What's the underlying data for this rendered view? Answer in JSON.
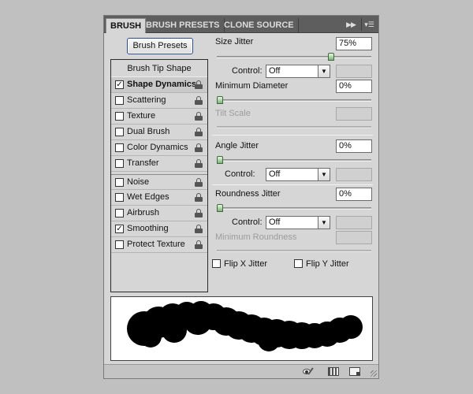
{
  "tabs": [
    {
      "label": "BRUSH",
      "active": true
    },
    {
      "label": "BRUSH PRESETS",
      "active": false
    },
    {
      "label": "CLONE SOURCE",
      "active": false
    }
  ],
  "tab_icons": {
    "more": "double-chevron-icon",
    "menu": "panel-menu-icon"
  },
  "brush_presets_button": "Brush Presets",
  "sidebar": {
    "header": "Brush Tip Shape",
    "items": [
      {
        "label": "Shape Dynamics",
        "checked": true,
        "selected": true
      },
      {
        "label": "Scattering",
        "checked": false
      },
      {
        "label": "Texture",
        "checked": false
      },
      {
        "label": "Dual Brush",
        "checked": false
      },
      {
        "label": "Color Dynamics",
        "checked": false
      },
      {
        "label": "Transfer",
        "checked": false
      },
      {
        "label": "Noise",
        "checked": false
      },
      {
        "label": "Wet Edges",
        "checked": false
      },
      {
        "label": "Airbrush",
        "checked": false
      },
      {
        "label": "Smoothing",
        "checked": true
      },
      {
        "label": "Protect Texture",
        "checked": false
      }
    ]
  },
  "settings": {
    "size_jitter": {
      "label": "Size Jitter",
      "value": "75%",
      "level": 0.75
    },
    "size_control": {
      "label": "Control:",
      "value": "Off"
    },
    "min_diameter": {
      "label": "Minimum Diameter",
      "value": "0%",
      "level": 0
    },
    "tilt_scale": {
      "label": "Tilt Scale",
      "disabled": true
    },
    "angle_jitter": {
      "label": "Angle Jitter",
      "value": "0%",
      "level": 0
    },
    "angle_control": {
      "label": "Control:",
      "value": "Off"
    },
    "roundness_jitter": {
      "label": "Roundness Jitter",
      "value": "0%",
      "level": 0
    },
    "roundness_control": {
      "label": "Control:",
      "value": "Off"
    },
    "min_roundness": {
      "label": "Minimum Roundness",
      "disabled": true
    },
    "flip_x": {
      "label": "Flip X Jitter",
      "checked": false
    },
    "flip_y": {
      "label": "Flip Y Jitter",
      "checked": false
    }
  },
  "footer_icons": [
    "toggle-live-tip-preview-icon",
    "brush-grid-icon",
    "create-new-brush-icon"
  ],
  "colors": {
    "panel": "#d6d6d6",
    "tab_bar": "#5e5e5e",
    "stroke": "#000000",
    "slider_thumb": "#7fb27a"
  }
}
